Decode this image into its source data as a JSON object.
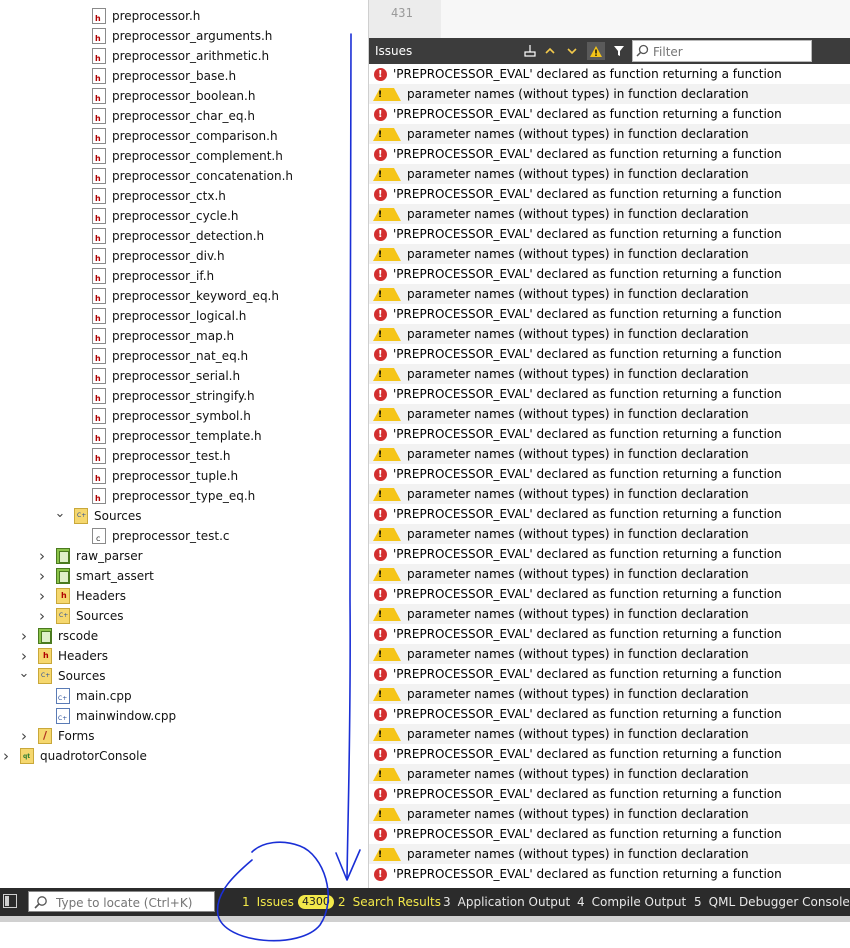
{
  "tree": {
    "items": [
      {
        "label": "preprocessor.h",
        "icon": "header-file-icon"
      },
      {
        "label": "preprocessor_arguments.h",
        "icon": "header-file-icon"
      },
      {
        "label": "preprocessor_arithmetic.h",
        "icon": "header-file-icon"
      },
      {
        "label": "preprocessor_base.h",
        "icon": "header-file-icon"
      },
      {
        "label": "preprocessor_boolean.h",
        "icon": "header-file-icon"
      },
      {
        "label": "preprocessor_char_eq.h",
        "icon": "header-file-icon"
      },
      {
        "label": "preprocessor_comparison.h",
        "icon": "header-file-icon"
      },
      {
        "label": "preprocessor_complement.h",
        "icon": "header-file-icon"
      },
      {
        "label": "preprocessor_concatenation.h",
        "icon": "header-file-icon"
      },
      {
        "label": "preprocessor_ctx.h",
        "icon": "header-file-icon"
      },
      {
        "label": "preprocessor_cycle.h",
        "icon": "header-file-icon"
      },
      {
        "label": "preprocessor_detection.h",
        "icon": "header-file-icon"
      },
      {
        "label": "preprocessor_div.h",
        "icon": "header-file-icon"
      },
      {
        "label": "preprocessor_if.h",
        "icon": "header-file-icon"
      },
      {
        "label": "preprocessor_keyword_eq.h",
        "icon": "header-file-icon"
      },
      {
        "label": "preprocessor_logical.h",
        "icon": "header-file-icon"
      },
      {
        "label": "preprocessor_map.h",
        "icon": "header-file-icon"
      },
      {
        "label": "preprocessor_nat_eq.h",
        "icon": "header-file-icon"
      },
      {
        "label": "preprocessor_serial.h",
        "icon": "header-file-icon"
      },
      {
        "label": "preprocessor_stringify.h",
        "icon": "header-file-icon"
      },
      {
        "label": "preprocessor_symbol.h",
        "icon": "header-file-icon"
      },
      {
        "label": "preprocessor_template.h",
        "icon": "header-file-icon"
      },
      {
        "label": "preprocessor_test.h",
        "icon": "header-file-icon"
      },
      {
        "label": "preprocessor_tuple.h",
        "icon": "header-file-icon"
      },
      {
        "label": "preprocessor_type_eq.h",
        "icon": "header-file-icon"
      },
      {
        "label": "Sources",
        "icon": "sources-folder-icon",
        "chevron": "expanded"
      },
      {
        "label": "preprocessor_test.c",
        "icon": "c-file-icon"
      },
      {
        "label": "raw_parser",
        "icon": "project-icon",
        "chevron": "collapsed"
      },
      {
        "label": "smart_assert",
        "icon": "project-icon",
        "chevron": "collapsed"
      },
      {
        "label": "Headers",
        "icon": "headers-folder-icon",
        "chevron": "collapsed"
      },
      {
        "label": "Sources",
        "icon": "sources-folder-icon",
        "chevron": "collapsed"
      },
      {
        "label": "rscode",
        "icon": "project-icon",
        "chevron": "collapsed"
      },
      {
        "label": "Headers",
        "icon": "headers-folder-icon",
        "chevron": "collapsed"
      },
      {
        "label": "Sources",
        "icon": "sources-folder-icon",
        "chevron": "expanded"
      },
      {
        "label": "main.cpp",
        "icon": "cpp-file-icon"
      },
      {
        "label": "mainwindow.cpp",
        "icon": "cpp-file-icon"
      },
      {
        "label": "Forms",
        "icon": "forms-folder-icon",
        "chevron": "collapsed"
      },
      {
        "label": "quadrotorConsole",
        "icon": "application-project-icon",
        "chevron": "collapsed"
      }
    ]
  },
  "editor": {
    "line_number": "431"
  },
  "issues": {
    "title": "Issues",
    "filter_placeholder": "Filter",
    "toolbar_icons": [
      "clean-icon",
      "previous-issue-icon",
      "next-issue-icon",
      "warning-filter-icon",
      "filter-icon",
      "search-icon"
    ],
    "error_text": "'PREPROCESSOR_EVAL' declared as function returning a function",
    "warning_text": "parameter names (without types) in function declaration",
    "rows": [
      {
        "kind": "error",
        "text": "'PREPROCESSOR_EVAL' declared as function returning a function"
      },
      {
        "kind": "warning",
        "text": "parameter names (without types) in function declaration"
      },
      {
        "kind": "error",
        "text": "'PREPROCESSOR_EVAL' declared as function returning a function"
      },
      {
        "kind": "warning",
        "text": "parameter names (without types) in function declaration"
      },
      {
        "kind": "error",
        "text": "'PREPROCESSOR_EVAL' declared as function returning a function"
      },
      {
        "kind": "warning",
        "text": "parameter names (without types) in function declaration"
      },
      {
        "kind": "error",
        "text": "'PREPROCESSOR_EVAL' declared as function returning a function"
      },
      {
        "kind": "warning",
        "text": "parameter names (without types) in function declaration"
      },
      {
        "kind": "error",
        "text": "'PREPROCESSOR_EVAL' declared as function returning a function"
      },
      {
        "kind": "warning",
        "text": "parameter names (without types) in function declaration"
      },
      {
        "kind": "error",
        "text": "'PREPROCESSOR_EVAL' declared as function returning a function"
      },
      {
        "kind": "warning",
        "text": "parameter names (without types) in function declaration"
      },
      {
        "kind": "error",
        "text": "'PREPROCESSOR_EVAL' declared as function returning a function"
      },
      {
        "kind": "warning",
        "text": "parameter names (without types) in function declaration"
      },
      {
        "kind": "error",
        "text": "'PREPROCESSOR_EVAL' declared as function returning a function"
      },
      {
        "kind": "warning",
        "text": "parameter names (without types) in function declaration"
      },
      {
        "kind": "error",
        "text": "'PREPROCESSOR_EVAL' declared as function returning a function"
      },
      {
        "kind": "warning",
        "text": "parameter names (without types) in function declaration"
      },
      {
        "kind": "error",
        "text": "'PREPROCESSOR_EVAL' declared as function returning a function"
      },
      {
        "kind": "warning",
        "text": "parameter names (without types) in function declaration"
      },
      {
        "kind": "error",
        "text": "'PREPROCESSOR_EVAL' declared as function returning a function"
      },
      {
        "kind": "warning",
        "text": "parameter names (without types) in function declaration"
      },
      {
        "kind": "error",
        "text": "'PREPROCESSOR_EVAL' declared as function returning a function"
      },
      {
        "kind": "warning",
        "text": "parameter names (without types) in function declaration"
      },
      {
        "kind": "error",
        "text": "'PREPROCESSOR_EVAL' declared as function returning a function"
      },
      {
        "kind": "warning",
        "text": "parameter names (without types) in function declaration"
      },
      {
        "kind": "error",
        "text": "'PREPROCESSOR_EVAL' declared as function returning a function"
      },
      {
        "kind": "warning",
        "text": "parameter names (without types) in function declaration"
      },
      {
        "kind": "error",
        "text": "'PREPROCESSOR_EVAL' declared as function returning a function"
      },
      {
        "kind": "warning",
        "text": "parameter names (without types) in function declaration"
      },
      {
        "kind": "error",
        "text": "'PREPROCESSOR_EVAL' declared as function returning a function"
      },
      {
        "kind": "warning",
        "text": "parameter names (without types) in function declaration"
      },
      {
        "kind": "error",
        "text": "'PREPROCESSOR_EVAL' declared as function returning a function"
      },
      {
        "kind": "warning",
        "text": "parameter names (without types) in function declaration"
      },
      {
        "kind": "error",
        "text": "'PREPROCESSOR_EVAL' declared as function returning a function"
      },
      {
        "kind": "warning",
        "text": "parameter names (without types) in function declaration"
      },
      {
        "kind": "error",
        "text": "'PREPROCESSOR_EVAL' declared as function returning a function"
      },
      {
        "kind": "warning",
        "text": "parameter names (without types) in function declaration"
      },
      {
        "kind": "error",
        "text": "'PREPROCESSOR_EVAL' declared as function returning a function"
      },
      {
        "kind": "warning",
        "text": "parameter names (without types) in function declaration"
      },
      {
        "kind": "error",
        "text": "'PREPROCESSOR_EVAL' declared as function returning a function"
      }
    ]
  },
  "statusbar": {
    "locate_placeholder": "Type to locate (Ctrl+K)",
    "tabs": [
      {
        "num": "1",
        "label": "Issues",
        "badge": "4300",
        "active": true
      },
      {
        "num": "2",
        "label": "Search Results",
        "active": true
      },
      {
        "num": "3",
        "label": "Application Output"
      },
      {
        "num": "4",
        "label": "Compile Output"
      },
      {
        "num": "5",
        "label": "QML Debugger Console"
      }
    ]
  },
  "colors": {
    "error": "#d32f2f",
    "warning": "#f5c518",
    "statusbar_bg": "#2b2b2b",
    "active_tab_text": "#f3e94a",
    "annotation_ink": "#1a2fd6"
  }
}
